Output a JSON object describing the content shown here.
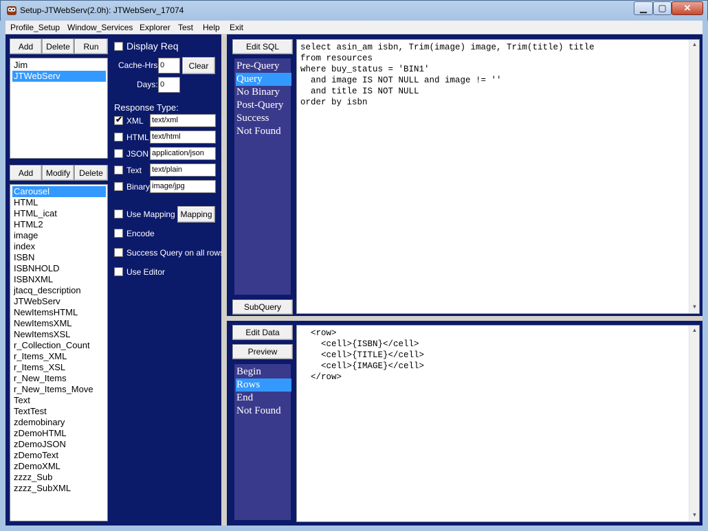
{
  "window": {
    "title": "Setup-JTWebServ(2.0h): JTWebServ_17074"
  },
  "menu": [
    "Profile_Setup",
    "Window_Services",
    "Explorer",
    "Test",
    "Help",
    "Exit"
  ],
  "profiles_toolbar": {
    "add": "Add",
    "delete": "Delete",
    "run": "Run"
  },
  "profiles": [
    {
      "label": "Jim",
      "selected": false
    },
    {
      "label": "JTWebServ",
      "selected": true
    }
  ],
  "services_toolbar": {
    "add": "Add",
    "modify": "Modify",
    "delete": "Delete"
  },
  "services": [
    {
      "label": "Carousel",
      "selected": true
    },
    {
      "label": "HTML"
    },
    {
      "label": "HTML_icat"
    },
    {
      "label": "HTML2"
    },
    {
      "label": "image"
    },
    {
      "label": "index"
    },
    {
      "label": "ISBN"
    },
    {
      "label": "ISBNHOLD"
    },
    {
      "label": "ISBNXML"
    },
    {
      "label": "jtacq_description"
    },
    {
      "label": "JTWebServ"
    },
    {
      "label": "NewItemsHTML"
    },
    {
      "label": "NewItemsXML"
    },
    {
      "label": "NewItemsXSL"
    },
    {
      "label": "r_Collection_Count"
    },
    {
      "label": "r_Items_XML"
    },
    {
      "label": "r_Items_XSL"
    },
    {
      "label": "r_New_Items"
    },
    {
      "label": "r_New_Items_Move"
    },
    {
      "label": "Text"
    },
    {
      "label": "TextTest"
    },
    {
      "label": "zdemobinary"
    },
    {
      "label": "zDemoHTML"
    },
    {
      "label": "zDemoJSON"
    },
    {
      "label": "zDemoText"
    },
    {
      "label": "zDemoXML"
    },
    {
      "label": "zzzz_Sub"
    },
    {
      "label": "zzzz_SubXML"
    }
  ],
  "settings": {
    "display_req": "Display Req",
    "cache_hrs_label": "Cache-Hrs:",
    "cache_hrs_value": "0",
    "clear": "Clear",
    "days_label": "Days:",
    "days_value": "0",
    "response_type_label": "Response Type:",
    "response_types": [
      {
        "label": "XML",
        "value": "text/xml",
        "checked": true
      },
      {
        "label": "HTML",
        "value": "text/html",
        "checked": false
      },
      {
        "label": "JSON",
        "value": "application/json",
        "checked": false
      },
      {
        "label": "Text",
        "value": "text/plain",
        "checked": false
      },
      {
        "label": "Binary",
        "value": "image/jpg",
        "checked": false
      }
    ],
    "use_mapping": "Use Mapping",
    "mapping": "Mapping",
    "encode": "Encode",
    "success_query": "Success Query on all rows",
    "use_editor": "Use Editor"
  },
  "sql_panel": {
    "edit_button": "Edit SQL",
    "subquery_button": "SubQuery",
    "sections": [
      {
        "label": "Pre-Query",
        "selected": false
      },
      {
        "label": "Query",
        "selected": true
      },
      {
        "label": "No Binary",
        "selected": false
      },
      {
        "label": "Post-Query",
        "selected": false
      },
      {
        "label": "Success",
        "selected": false
      },
      {
        "label": "Not Found",
        "selected": false
      }
    ],
    "code": "select asin_am isbn, Trim(image) image, Trim(title) title\nfrom resources\nwhere buy_status = 'BIN1'\n  and image IS NOT NULL and image != ''\n  and title IS NOT NULL\norder by isbn"
  },
  "data_panel": {
    "edit_button": "Edit Data",
    "preview_button": "Preview",
    "sections": [
      {
        "label": "Begin",
        "selected": false
      },
      {
        "label": "Rows",
        "selected": true
      },
      {
        "label": "End",
        "selected": false
      },
      {
        "label": "Not Found",
        "selected": false
      }
    ],
    "code": "  <row>\n    <cell>{ISBN}</cell>\n    <cell>{TITLE}</cell>\n    <cell>{IMAGE}</cell>\n  </row>"
  }
}
